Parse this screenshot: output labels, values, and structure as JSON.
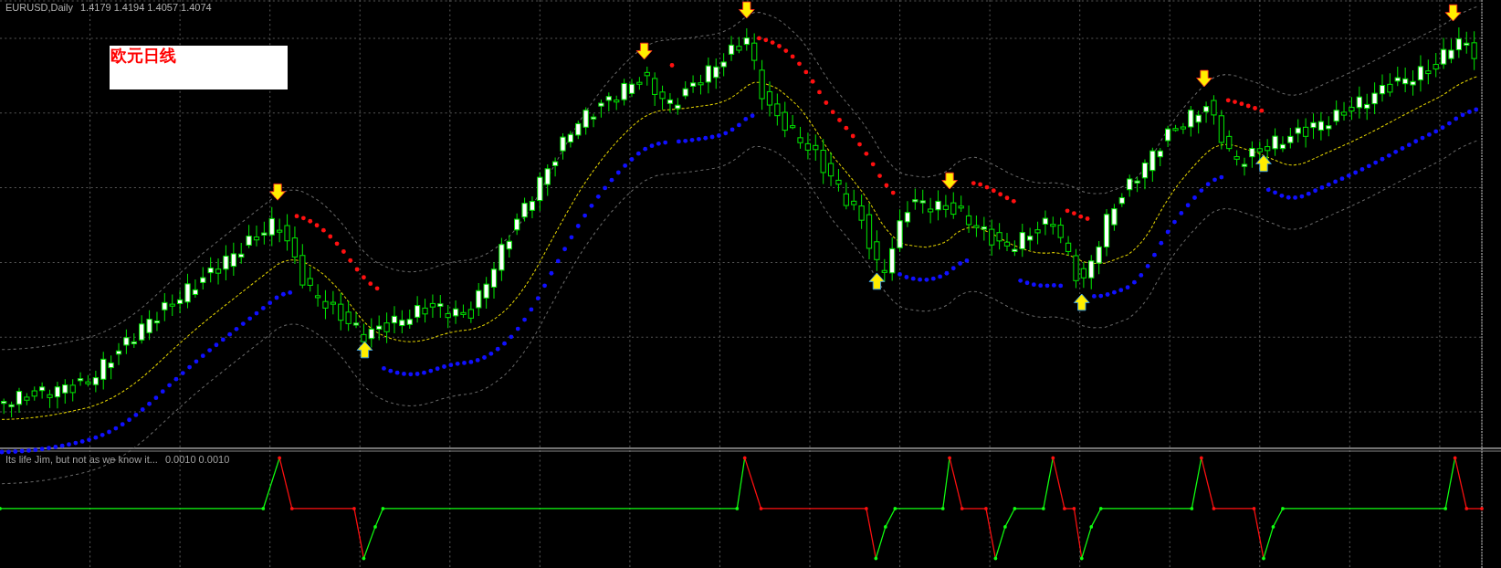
{
  "main_chart": {
    "symbol": "EURUSD,Daily",
    "ohlc": "1.4179 1.4194 1.4057 1.4074",
    "label_box": "欧元日线"
  },
  "indicator_window": {
    "title": "Its life Jim, but not as we know it...",
    "values": "0.0010 0.0010"
  }
}
